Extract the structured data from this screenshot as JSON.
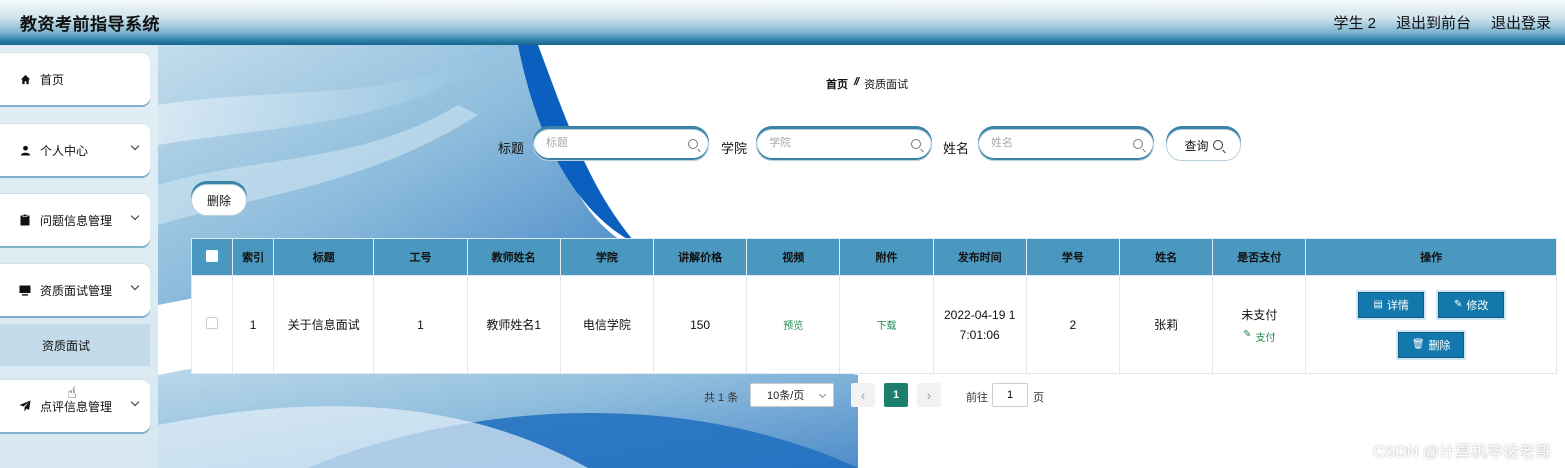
{
  "header": {
    "title": "教资考前指导系统",
    "user": "学生 2",
    "back_to_front": "退出到前台",
    "logout": "退出登录"
  },
  "sidebar": {
    "items": [
      {
        "label": "首页",
        "icon": "home-icon"
      },
      {
        "label": "个人中心",
        "icon": "user-icon"
      },
      {
        "label": "问题信息管理",
        "icon": "clipboard-icon"
      },
      {
        "label": "资质面试管理",
        "icon": "monitor-icon"
      },
      {
        "label": "点评信息管理",
        "icon": "paper-plane-icon"
      }
    ],
    "sub_item": "资质面试"
  },
  "breadcrumb": {
    "home": "首页",
    "separator": "//",
    "current": "资质面试"
  },
  "search": {
    "title_label": "标题",
    "title_placeholder": "标题",
    "college_label": "学院",
    "college_placeholder": "学院",
    "name_label": "姓名",
    "name_placeholder": "姓名",
    "query_button": "查询"
  },
  "actions": {
    "delete_button": "删除"
  },
  "table": {
    "headers": [
      "索引",
      "标题",
      "工号",
      "教师姓名",
      "学院",
      "讲解价格",
      "视频",
      "附件",
      "发布时间",
      "学号",
      "姓名",
      "是否支付",
      "操作"
    ],
    "rows": [
      {
        "index": "1",
        "title": "关于信息面试",
        "job_no": "1",
        "teacher": "教师姓名1",
        "college": "电信学院",
        "price": "150",
        "video": "预览",
        "attachment": "下载",
        "time_line1": "2022-04-19 1",
        "time_line2": "7:01:06",
        "student_no": "2",
        "name": "张莉",
        "paid": "未支付",
        "pay_link": "支付",
        "detail_btn": "详情",
        "edit_btn": "修改",
        "delete_btn": "删除"
      }
    ]
  },
  "pagination": {
    "total": "共 1 条",
    "page_size": "10条/页",
    "current_page": "1",
    "goto_label": "前往",
    "goto_value": "1",
    "page_unit": "页"
  },
  "watermark": "CSDN @计算机毕设老哥",
  "colors": {
    "accent": "#1379ad",
    "table_header": "#4a98bf",
    "active_page": "#1b7f6b",
    "link": "#1b8a4e"
  }
}
